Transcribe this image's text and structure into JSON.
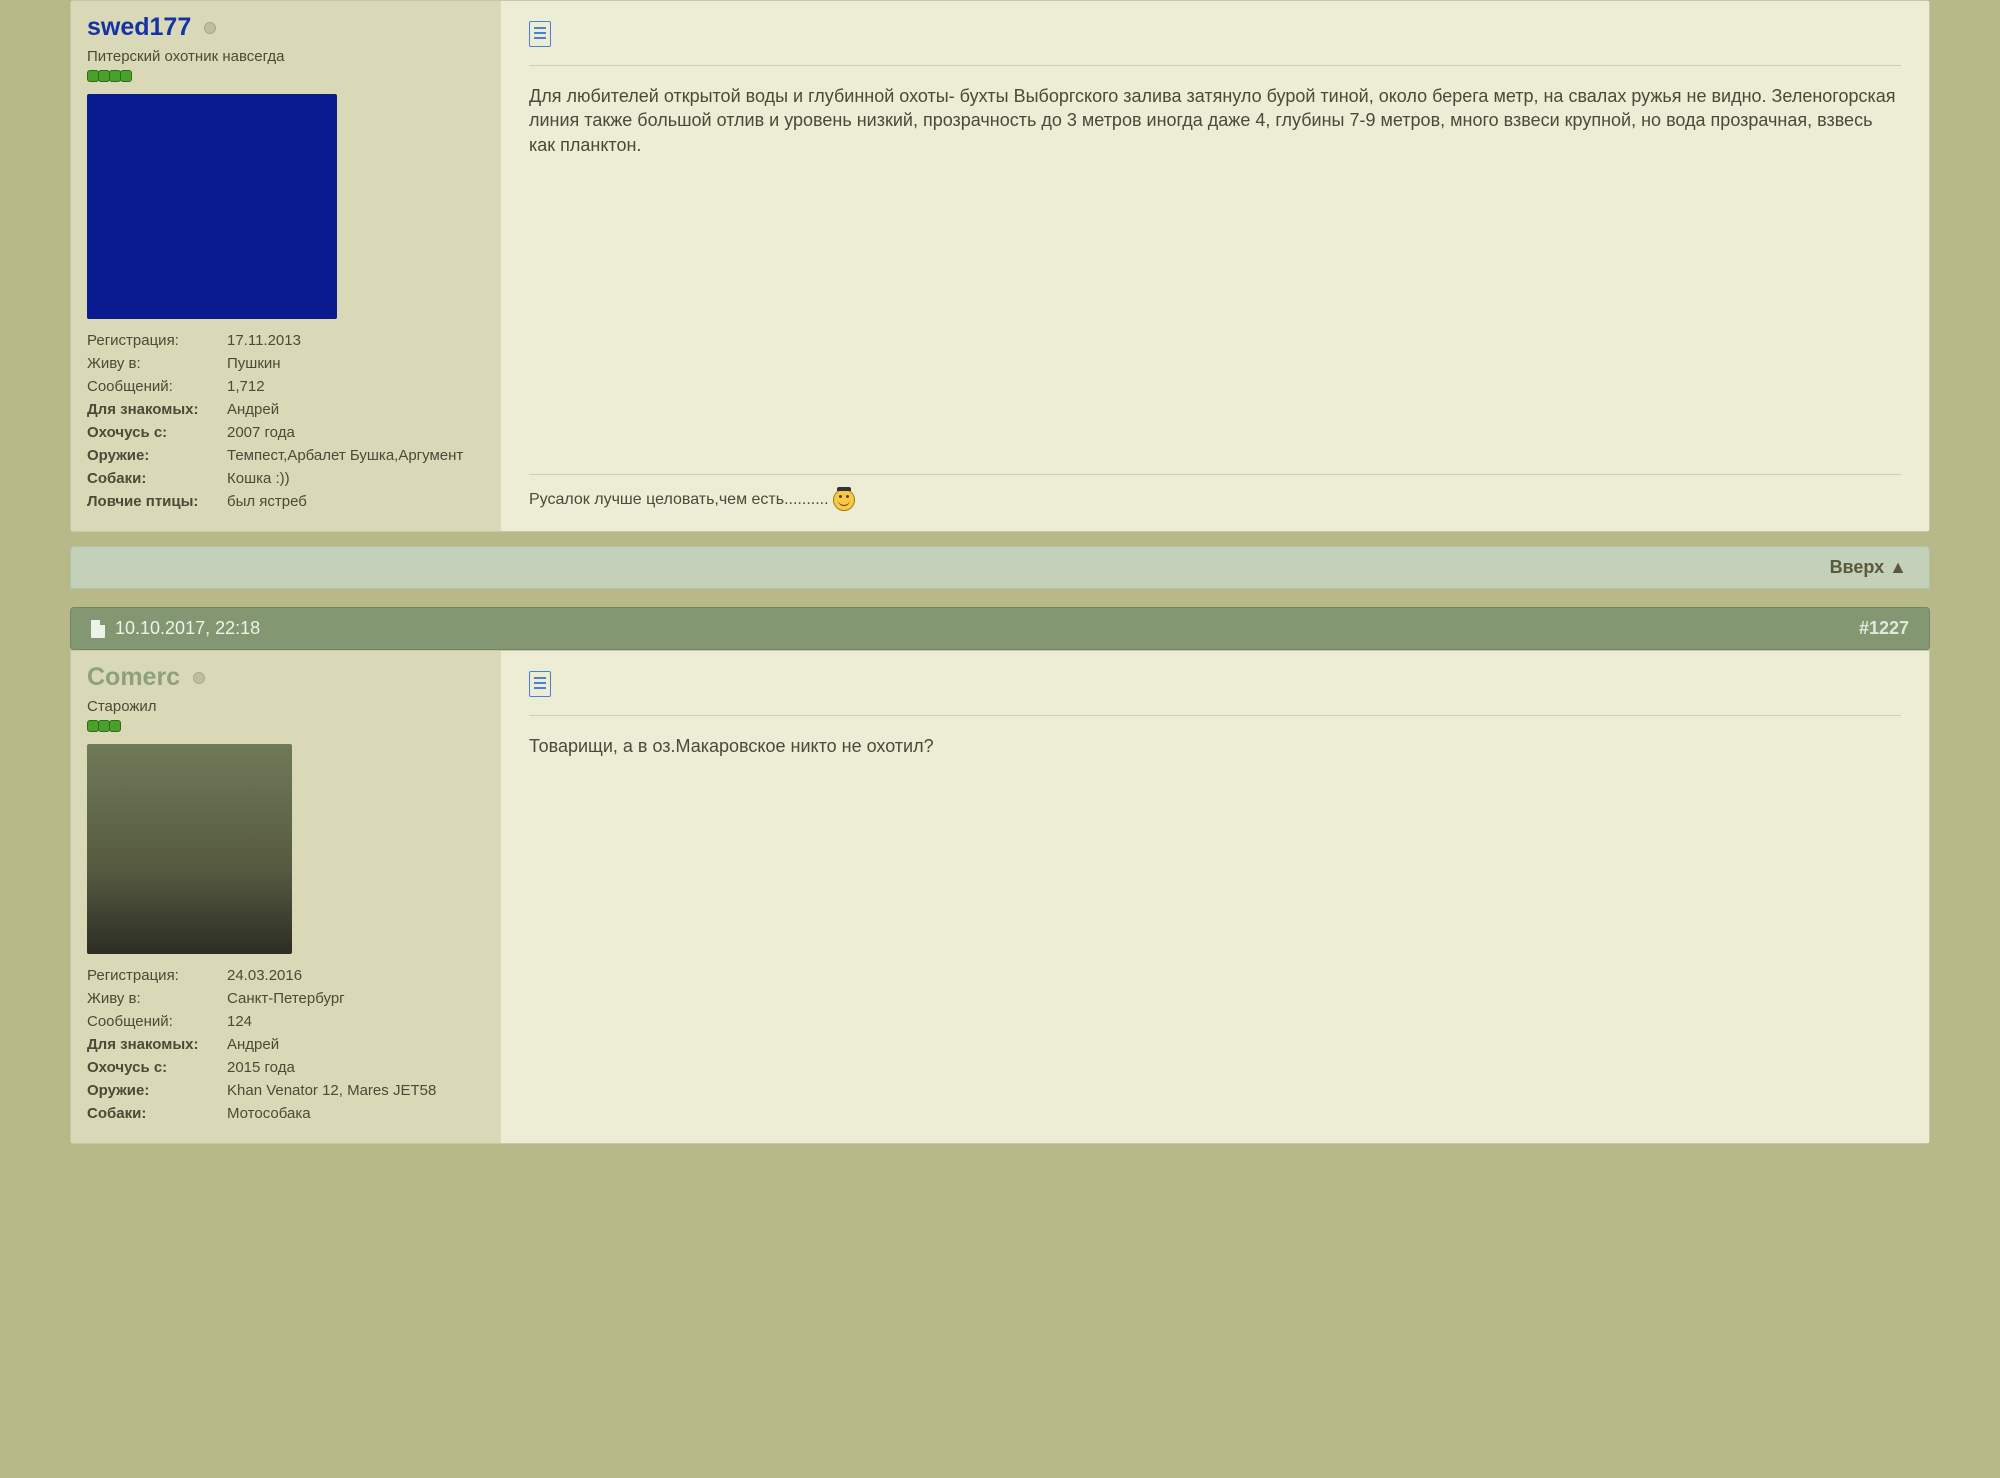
{
  "post1": {
    "username": "swed177",
    "usertitle": "Питерский охотник навсегда",
    "pip_count": 4,
    "profile": {
      "reg_label": "Регистрация:",
      "reg_value": "17.11.2013",
      "live_label": "Живу в:",
      "live_value": "Пушкин",
      "posts_label": "Сообщений:",
      "posts_value": "1,712",
      "friends_label": "Для знакомых:",
      "friends_value": "Андрей",
      "hunt_label": "Охочусь с:",
      "hunt_value": "2007 года",
      "weapon_label": "Оружие:",
      "weapon_value": "Темпест,Арбалет Бушка,Аргумент",
      "dogs_label": "Собаки:",
      "dogs_value": "Кошка :))",
      "birds_label": "Ловчие птицы:",
      "birds_value": "был ястреб"
    },
    "message": "Для любителей открытой воды и глубинной охоты- бухты Выборгского залива затянуло бурой тиной, около берега метр, на свалах ружья не видно. Зеленогорская линия также большой отлив и уровень низкий, прозрачность до 3 метров иногда даже 4, глубины 7-9 метров, много взвеси крупной, но вода прозрачная, взвесь как планктон.",
    "signature": "Русалок лучше целовать,чем есть.........."
  },
  "back_to_top": "Вверх ▲",
  "post2_head": {
    "datetime": "10.10.2017, 22:18",
    "post_no": "#1227"
  },
  "post2": {
    "username": "Comerc",
    "usertitle": "Старожил",
    "pip_count": 3,
    "profile": {
      "reg_label": "Регистрация:",
      "reg_value": "24.03.2016",
      "live_label": "Живу в:",
      "live_value": "Санкт-Петербург",
      "posts_label": "Сообщений:",
      "posts_value": "124",
      "friends_label": "Для знакомых:",
      "friends_value": "Андрей",
      "hunt_label": "Охочусь с:",
      "hunt_value": "2015 года",
      "weapon_label": "Оружие:",
      "weapon_value": "Khan Venator 12, Mares JET58",
      "dogs_label": "Собаки:",
      "dogs_value": "Мотособака"
    },
    "message": "Товарищи, а в оз.Макаровское никто не охотил?"
  }
}
